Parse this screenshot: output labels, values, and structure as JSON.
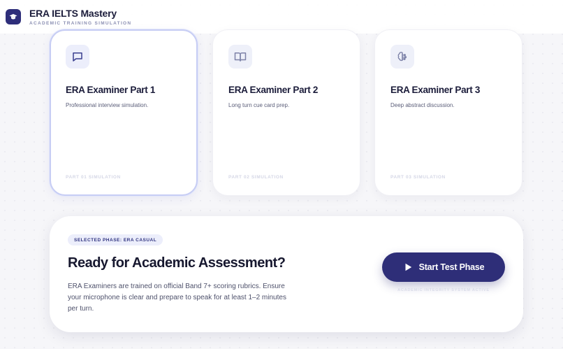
{
  "header": {
    "title": "ERA IELTS Mastery",
    "subtitle": "ACADEMIC TRAINING SIMULATION",
    "logo_icon": "graduation-cap-icon"
  },
  "cards": [
    {
      "title": "ERA Examiner Part 1",
      "description": "Professional interview simulation.",
      "footer": "PART 01 SIMULATION",
      "icon": "message-square-icon",
      "selected": true
    },
    {
      "title": "ERA Examiner Part 2",
      "description": "Long turn cue card prep.",
      "footer": "PART 02 SIMULATION",
      "icon": "book-open-icon",
      "selected": false
    },
    {
      "title": "ERA Examiner Part 3",
      "description": "Deep abstract discussion.",
      "footer": "PART 03 SIMULATION",
      "icon": "brain-icon",
      "selected": false
    }
  ],
  "panel": {
    "badge": "SELECTED PHASE: ERA CASUAL",
    "title": "Ready for Academic Assessment?",
    "body": "ERA Examiners are trained on official Band 7+ scoring rubrics. Ensure your microphone is clear and prepare to speak for at least 1–2 minutes per turn.",
    "start_button": "Start Test Phase",
    "status_note": "ACADEMIC INTEGRITY SYSTEM ACTIVE"
  },
  "colors": {
    "brand": "#2e2e78",
    "accent_border": "#c7cdf4",
    "badge_bg": "#eceefb"
  }
}
